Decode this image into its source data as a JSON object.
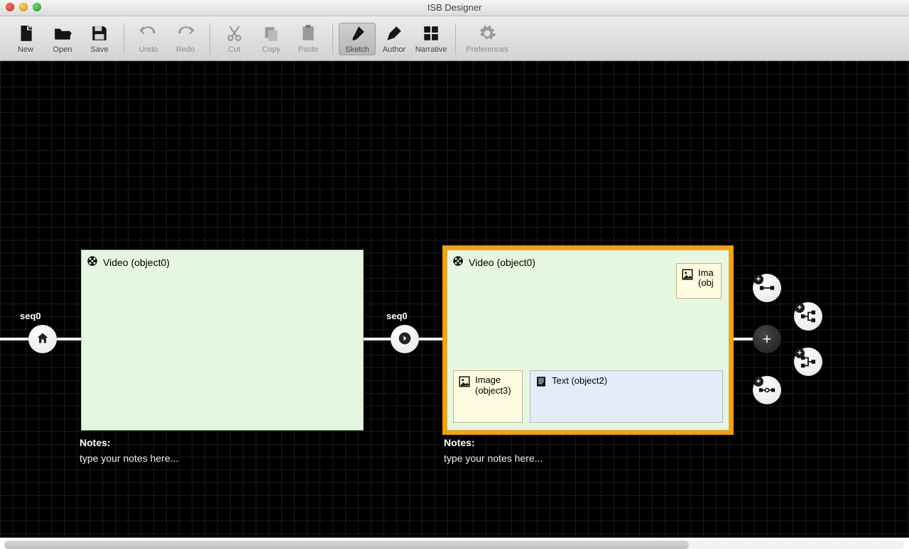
{
  "window": {
    "title": "ISB Designer"
  },
  "toolbar": {
    "new": "New",
    "open": "Open",
    "save": "Save",
    "undo": "Undo",
    "redo": "Redo",
    "cut": "Cut",
    "copy": "Copy",
    "paste": "Paste",
    "sketch": "Sketch",
    "author": "Author",
    "narrative": "Narrative",
    "preferences": "Preferences"
  },
  "seq": {
    "left_label": "seq0",
    "right_label": "seq0"
  },
  "scene_left": {
    "title": "Video (object0)",
    "notes_label": "Notes:",
    "notes_placeholder": "type your notes here..."
  },
  "scene_right": {
    "title": "Video (object0)",
    "image_top_label": "Ima (obj",
    "image_label": "Image (object3)",
    "text_label": "Text (object2)",
    "notes_label": "Notes:",
    "notes_placeholder": "type your notes here..."
  }
}
